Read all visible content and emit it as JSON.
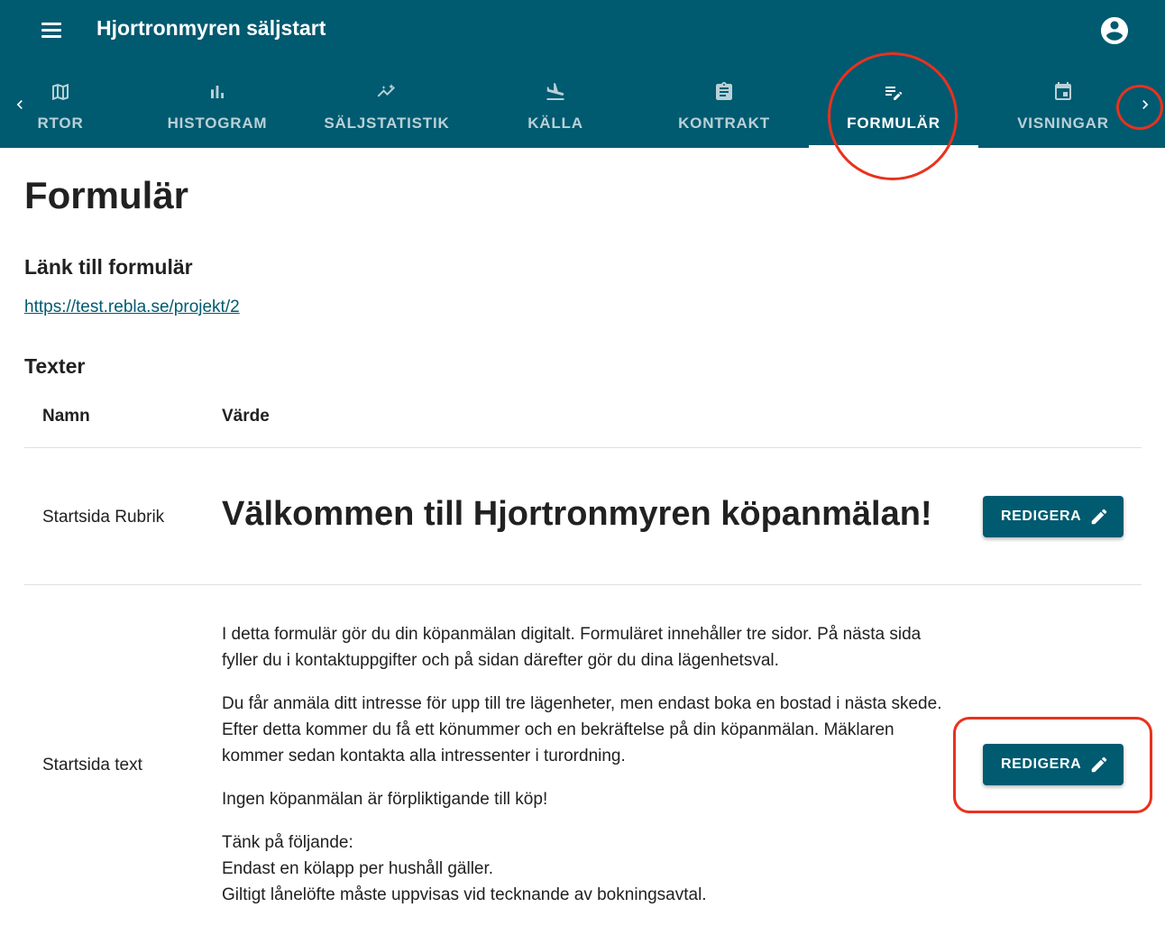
{
  "app": {
    "title": "Hjortronmyren säljstart",
    "menu_icon": "menu-icon",
    "account_icon": "account-circle-icon",
    "brand_color": "#005a70"
  },
  "tabs": [
    {
      "label": "RTOR",
      "icon": "map-icon",
      "active": false
    },
    {
      "label": "HISTOGRAM",
      "icon": "bar-chart-icon",
      "active": false
    },
    {
      "label": "SÄLJSTATISTIK",
      "icon": "insights-icon",
      "active": false
    },
    {
      "label": "KÄLLA",
      "icon": "flight-land-icon",
      "active": false
    },
    {
      "label": "KONTRAKT",
      "icon": "assignment-icon",
      "active": false
    },
    {
      "label": "FORMULÄR",
      "icon": "edit-note-icon",
      "active": true
    },
    {
      "label": "VISNINGAR",
      "icon": "calendar-icon",
      "active": false
    }
  ],
  "page": {
    "title": "Formulär",
    "link_section_title": "Länk till formulär",
    "link_url": "https://test.rebla.se/projekt/2",
    "texts_section_title": "Texter"
  },
  "table": {
    "headers": {
      "name": "Namn",
      "value": "Värde"
    },
    "rows": [
      {
        "name": "Startsida Rubrik",
        "value": "Välkommen till Hjortronmyren köpanmälan!",
        "button_label": "REDIGERA"
      },
      {
        "name": "Startsida text",
        "paragraphs": [
          "I detta formulär gör du din köpanmälan digitalt. Formuläret innehåller tre sidor. På nästa sida fyller du i kontaktuppgifter och på sidan därefter gör du dina lägenhetsval.",
          "Du får anmäla ditt intresse för upp till tre lägenheter, men endast boka en bostad i nästa skede. Efter detta kommer du få ett könummer och en bekräftelse på din köpanmälan. Mäklaren kommer sedan kontakta alla intressenter i turordning.",
          "Ingen köpanmälan är förpliktigande till köp!"
        ],
        "lines": [
          "Tänk på följande:",
          "Endast en kölapp per hushåll gäller.",
          "Giltigt lånelöfte måste uppvisas vid tecknande av bokningsavtal."
        ],
        "button_label": "REDIGERA"
      }
    ]
  },
  "annotation_color": "#e8321e"
}
